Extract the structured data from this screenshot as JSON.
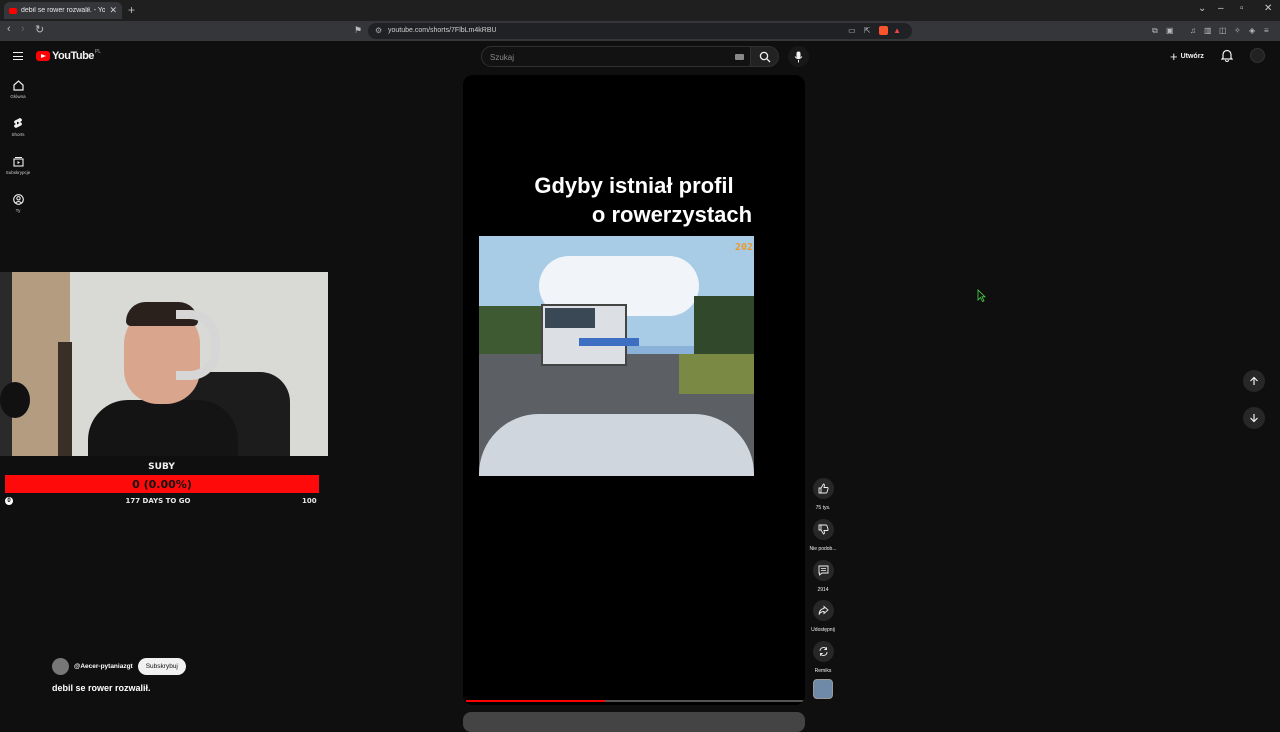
{
  "browser": {
    "tab_title": "debil se rower rozwalił. - You",
    "url": "youtube.com/shorts/7FlbLm4kRBU"
  },
  "header": {
    "logo_text": "YouTube",
    "region": "PL",
    "search_placeholder": "Szukaj",
    "create_label": "Utwórz"
  },
  "guide": {
    "items": [
      {
        "label": "Główna",
        "icon": "home-icon"
      },
      {
        "label": "Shorts",
        "icon": "shorts-icon"
      },
      {
        "label": "Subskrypcje",
        "icon": "subscriptions-icon"
      },
      {
        "label": "Ty",
        "icon": "you-icon"
      }
    ]
  },
  "overlay": {
    "subs_label": "SUBY",
    "subs_value": "0 (0.00%)",
    "subs_fraction": 0.0,
    "subs_min": "0",
    "subs_days": "177 DAYS TO GO",
    "subs_max": "100"
  },
  "short": {
    "title_line1": "Gdyby istniał profil",
    "title_line2": "o rowerzystach",
    "clip_year": "202",
    "progress_fraction": 0.41
  },
  "actions": {
    "like_label": "75 tys.",
    "dislike_label": "Nie podob...",
    "comments_label": "2914",
    "share_label": "Udostępnij",
    "remix_label": "Remiks"
  },
  "channel": {
    "name": "@Aecer-pytaniazgt",
    "subscribe_label": "Subskrybuj",
    "caption": "debil se rower rozwalił."
  }
}
